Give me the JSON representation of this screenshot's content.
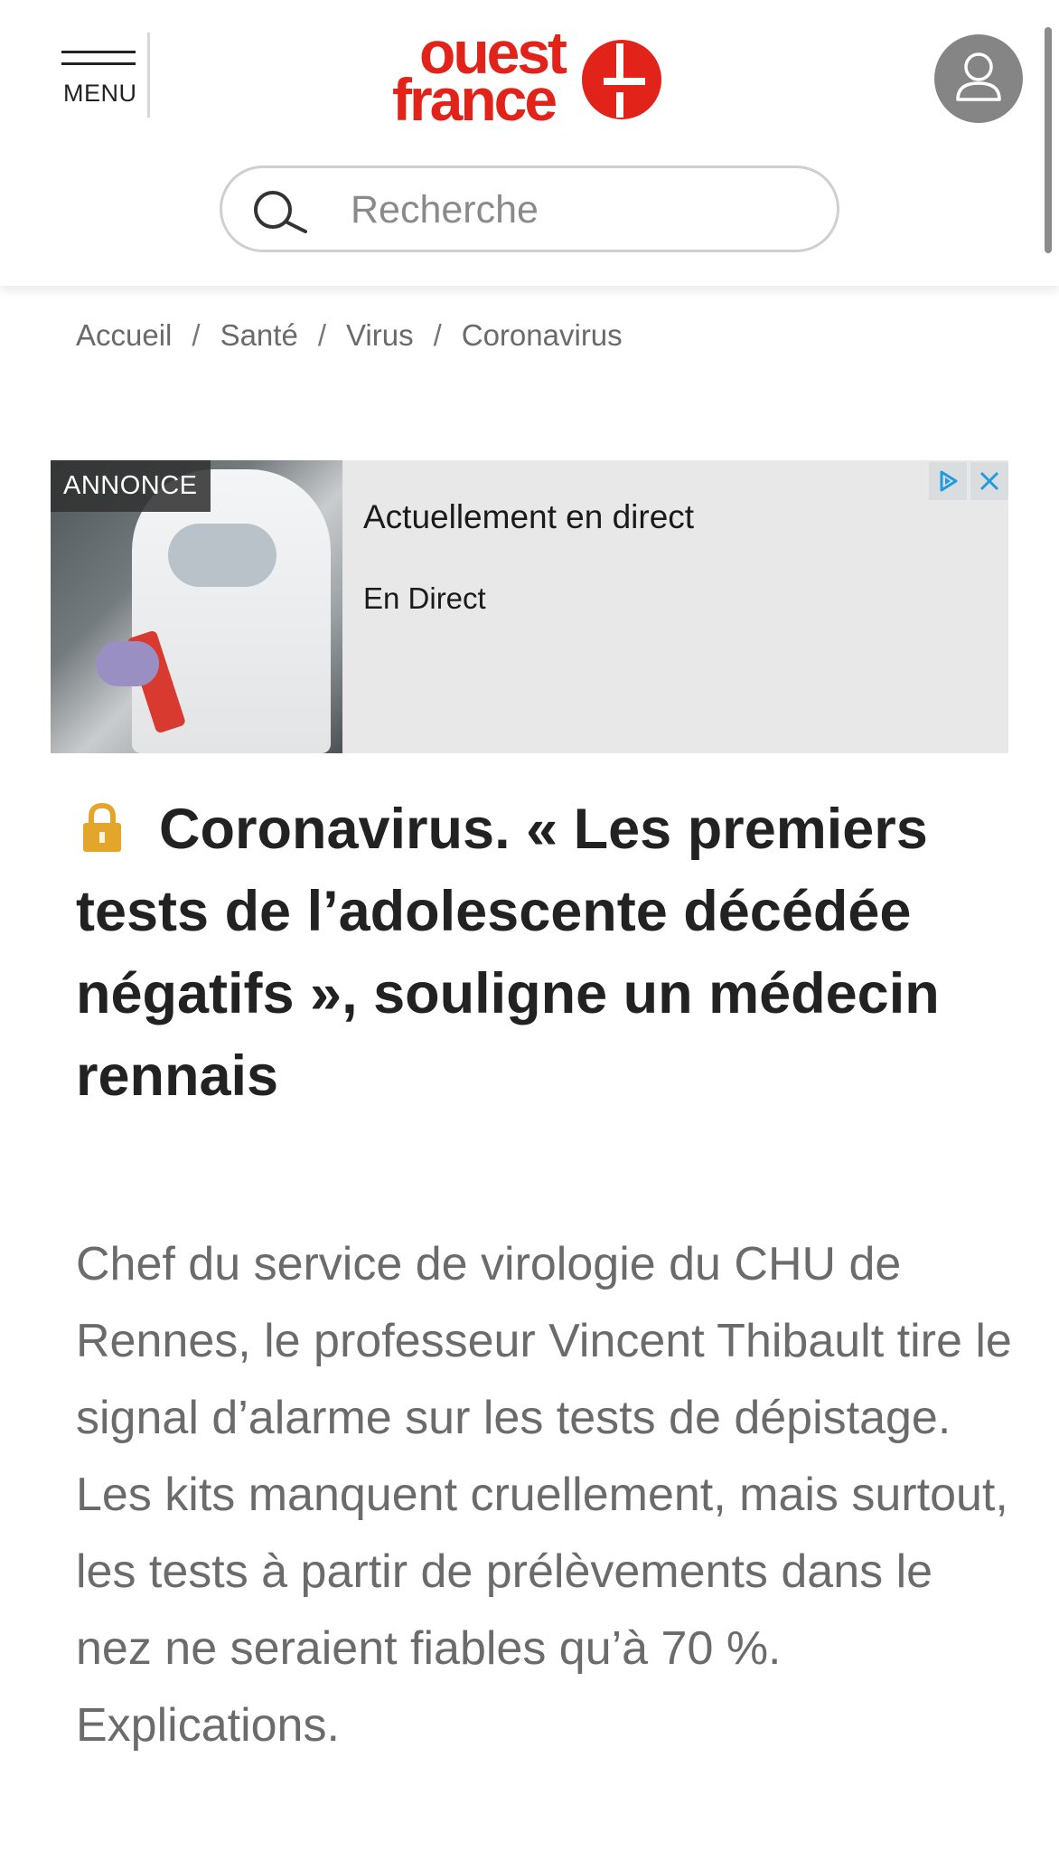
{
  "header": {
    "menu_label": "MENU",
    "logo_line1": "ouest",
    "logo_line2": "france",
    "search_placeholder": "Recherche",
    "brand_color": "#e2231a"
  },
  "breadcrumb": {
    "items": [
      "Accueil",
      "Santé",
      "Virus",
      "Coronavirus"
    ],
    "separator": "/"
  },
  "ad": {
    "badge": "ANNONCE",
    "title": "Actuellement en direct",
    "subtitle": "En Direct",
    "choices_icon": "adchoices-icon",
    "close_icon": "close-icon"
  },
  "article": {
    "headline": "Coronavirus. « Les premiers tests de l’adolescente décédée négatifs », souligne un médecin rennais",
    "lede": "Chef du service de virologie du CHU de Rennes, le professeur Vincent Thibault tire le signal d’alarme sur les tests de dépistage. Les kits manquent cruellement, mais surtout, les tests à partir de prélèvements dans le nez ne seraient fiables qu’à 70 %. Explications.",
    "premium_icon": "lock-icon",
    "premium_color": "#e3a62a"
  }
}
